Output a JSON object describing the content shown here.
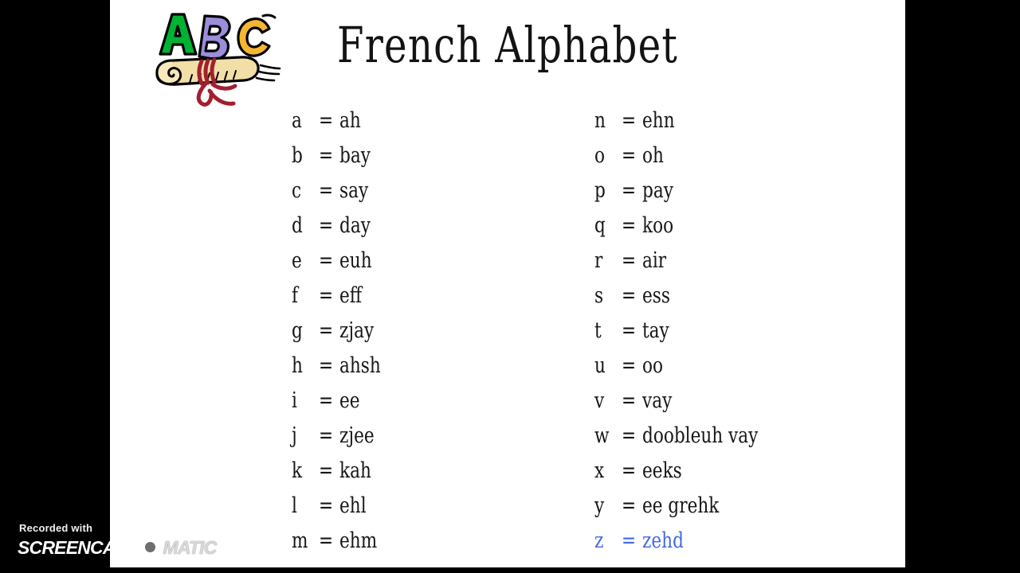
{
  "slide": {
    "title": "French Alphabet",
    "background_color": "#ffffff",
    "frame_color": "#000000",
    "highlight_color": "#4169e1"
  },
  "clipart": {
    "name": "abc-scroll-clipart",
    "letters": [
      {
        "glyph": "A",
        "color": "#00b233"
      },
      {
        "glyph": "B",
        "color": "#9b8ddb"
      },
      {
        "glyph": "C",
        "color": "#f5b731"
      }
    ],
    "scroll_color": "#f2dfa8",
    "ribbon_color": "#a31f2e"
  },
  "equals_sign": "=",
  "columns": {
    "left": [
      {
        "letter": "a",
        "sound": "ah",
        "highlight": false
      },
      {
        "letter": "b",
        "sound": "bay",
        "highlight": false
      },
      {
        "letter": "c",
        "sound": "say",
        "highlight": false
      },
      {
        "letter": "d",
        "sound": "day",
        "highlight": false
      },
      {
        "letter": "e",
        "sound": "euh",
        "highlight": false
      },
      {
        "letter": "f",
        "sound": "eff",
        "highlight": false
      },
      {
        "letter": "g",
        "sound": "zjay",
        "highlight": false
      },
      {
        "letter": "h",
        "sound": "ahsh",
        "highlight": false
      },
      {
        "letter": "i",
        "sound": "ee",
        "highlight": false
      },
      {
        "letter": "j",
        "sound": "zjee",
        "highlight": false
      },
      {
        "letter": "k",
        "sound": "kah",
        "highlight": false
      },
      {
        "letter": "l",
        "sound": "ehl",
        "highlight": false
      },
      {
        "letter": "m",
        "sound": "ehm",
        "highlight": false
      }
    ],
    "right": [
      {
        "letter": "n",
        "sound": "ehn",
        "highlight": false
      },
      {
        "letter": "o",
        "sound": "oh",
        "highlight": false
      },
      {
        "letter": "p",
        "sound": "pay",
        "highlight": false
      },
      {
        "letter": "q",
        "sound": "koo",
        "highlight": false
      },
      {
        "letter": "r",
        "sound": "air",
        "highlight": false
      },
      {
        "letter": "s",
        "sound": "ess",
        "highlight": false
      },
      {
        "letter": "t",
        "sound": "tay",
        "highlight": false
      },
      {
        "letter": "u",
        "sound": "oo",
        "highlight": false
      },
      {
        "letter": "v",
        "sound": "vay",
        "highlight": false
      },
      {
        "letter": "w",
        "sound": "doobleuh vay",
        "highlight": false
      },
      {
        "letter": "x",
        "sound": "eeks",
        "highlight": false
      },
      {
        "letter": "y",
        "sound": "ee grehk",
        "highlight": false
      },
      {
        "letter": "z",
        "sound": "zehd",
        "highlight": true
      }
    ]
  },
  "watermark": {
    "top_line": "Recorded with",
    "brand_first": "SCREENCAST",
    "brand_last": "MATIC"
  }
}
